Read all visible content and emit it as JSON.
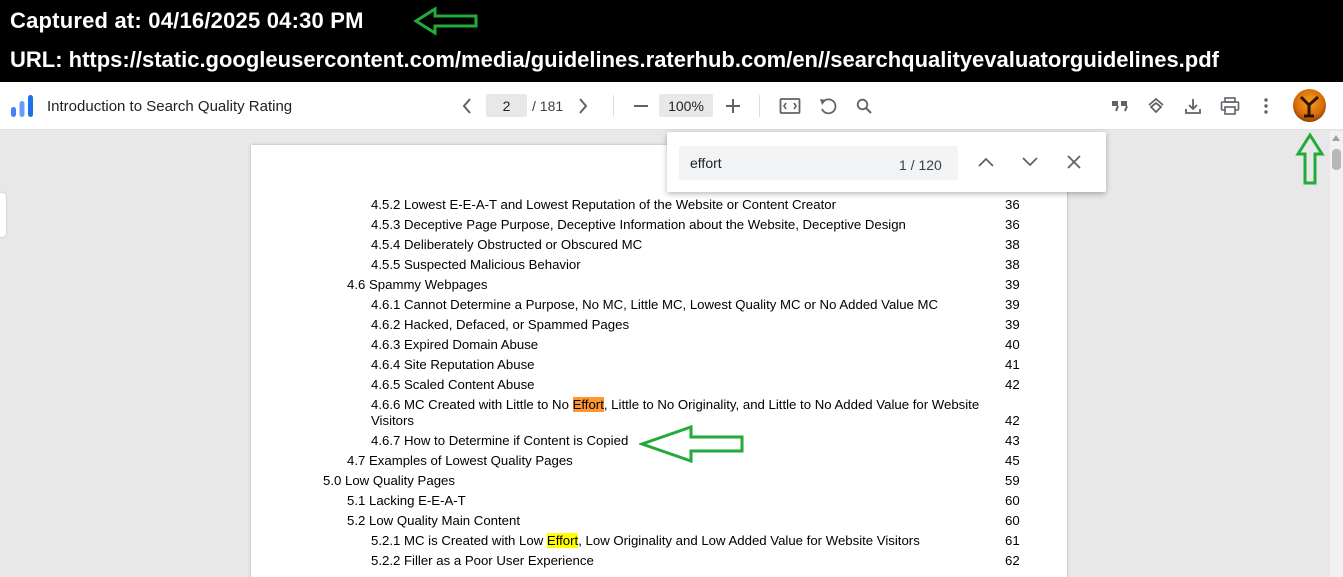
{
  "banner": {
    "captured": "Captured at: 04/16/2025 04:30 PM",
    "url": "URL: https://static.googleusercontent.com/media/guidelines.raterhub.com/en//searchqualityevaluatorguidelines.pdf"
  },
  "toolbar": {
    "title": "Introduction to Search Quality Rating",
    "page_current": "2",
    "page_total": "/ 181",
    "zoom": "100%"
  },
  "find": {
    "query": "effort",
    "count": "1 / 120"
  },
  "colors": {
    "current_match": "#ff9632",
    "other_match": "#ffff00",
    "annotation_arrow": "#22aa3a"
  },
  "toc": [
    {
      "pre": "4.5.2 Lowest E-E-A-T and Lowest Reputation of the Website or Content Creator",
      "page": "36"
    },
    {
      "pre": "4.5.3 Deceptive Page Purpose, Deceptive Information about the Website, Deceptive Design",
      "page": "36"
    },
    {
      "pre": "4.5.4 Deliberately Obstructed or Obscured MC",
      "page": "38"
    },
    {
      "pre": "4.5.5 Suspected Malicious Behavior",
      "page": "38"
    },
    {
      "pre": "4.6 Spammy Webpages",
      "page": "39"
    },
    {
      "pre": "4.6.1 Cannot Determine a Purpose, No MC, Little MC, Lowest Quality MC or No Added Value MC",
      "page": "39"
    },
    {
      "pre": "4.6.2 Hacked, Defaced, or Spammed Pages",
      "page": "39"
    },
    {
      "pre": "4.6.3 Expired Domain Abuse",
      "page": "40"
    },
    {
      "pre": "4.6.4 Site Reputation Abuse",
      "page": "41"
    },
    {
      "pre": "4.6.5 Scaled Content Abuse",
      "page": "42"
    },
    {
      "pre": "4.6.6 MC Created with Little to No ",
      "match": "Effort",
      "post": ", Little to No Originality, and Little to No Added Value for Website",
      "line2": "Visitors",
      "page": "42"
    },
    {
      "pre": "4.6.7 How to Determine if Content is Copied",
      "page": "43"
    },
    {
      "pre": "4.7 Examples of Lowest Quality Pages",
      "page": "45"
    },
    {
      "pre": "5.0 Low Quality Pages",
      "page": "59"
    },
    {
      "pre": "5.1 Lacking E-E-A-T",
      "page": "60"
    },
    {
      "pre": "5.2 Low Quality Main Content",
      "page": "60"
    },
    {
      "pre": "5.2.1 MC is Created with Low ",
      "match": "Effort",
      "post": ", Low Originality and Low Added Value for Website Visitors",
      "page": "61"
    },
    {
      "pre": "5.2.2 Filler as a Poor User Experience",
      "page": "62"
    }
  ]
}
